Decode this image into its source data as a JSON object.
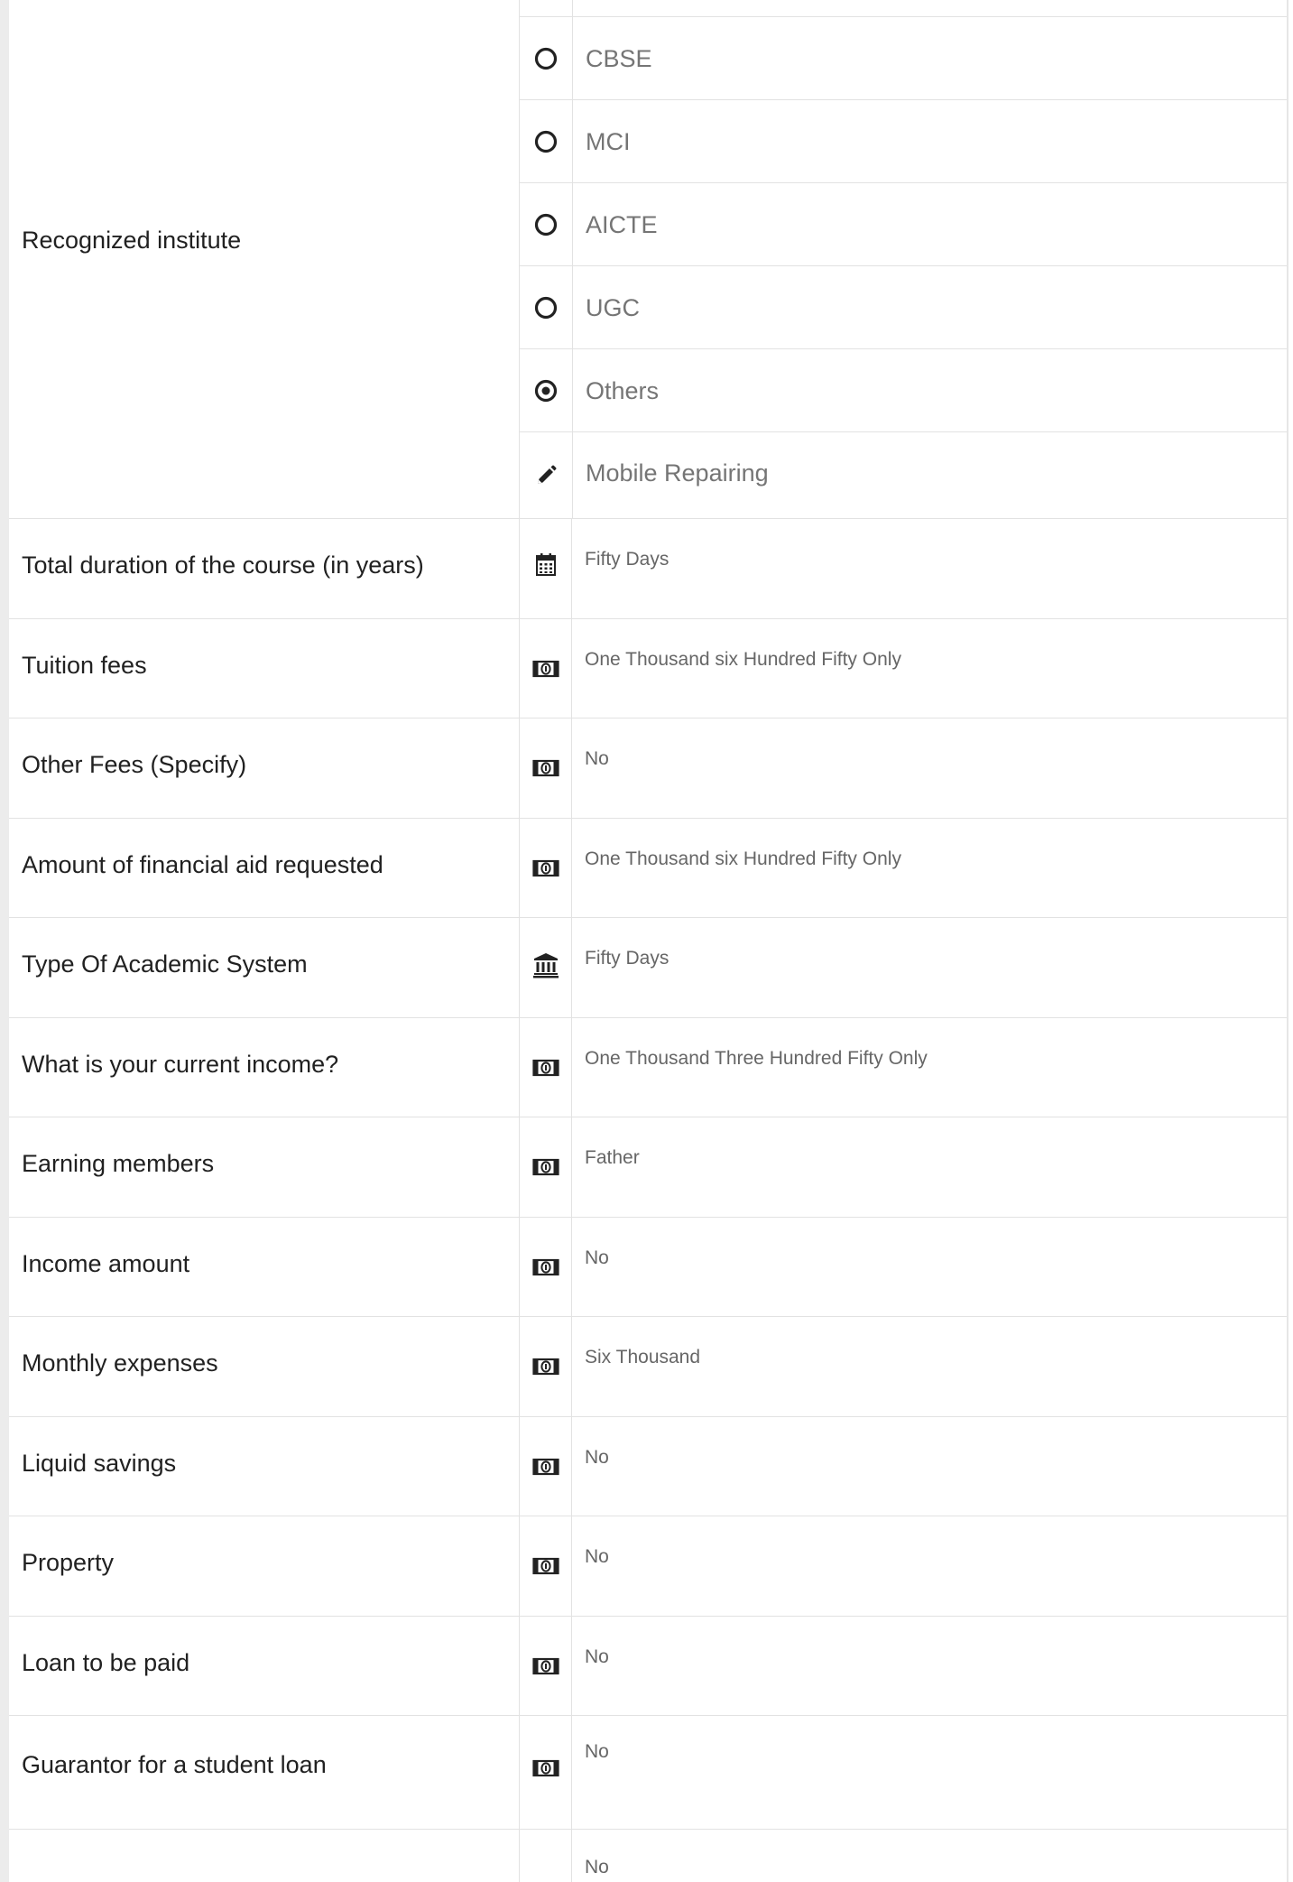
{
  "recognized_institute": {
    "label": "Recognized institute",
    "options": [
      {
        "label": "CBSE",
        "icon": "radio-unchecked-icon",
        "selected": false
      },
      {
        "label": "MCI",
        "icon": "radio-unchecked-icon",
        "selected": false
      },
      {
        "label": "AICTE",
        "icon": "radio-unchecked-icon",
        "selected": false
      },
      {
        "label": "UGC",
        "icon": "radio-unchecked-icon",
        "selected": false
      },
      {
        "label": "Others",
        "icon": "radio-checked-icon",
        "selected": true
      },
      {
        "label": "Mobile Repairing",
        "icon": "pencil-icon",
        "selected": false
      }
    ]
  },
  "fields": [
    {
      "label": "Total duration of the course (in years)",
      "value": "Fifty Days",
      "icon": "calendar-icon"
    },
    {
      "label": "Tuition fees",
      "value": "One Thousand six Hundred Fifty Only",
      "icon": "money-icon"
    },
    {
      "label": "Other Fees (Specify)",
      "value": "No",
      "icon": "money-icon"
    },
    {
      "label": "Amount of financial aid requested",
      "value": "One Thousand six Hundred Fifty Only",
      "icon": "money-icon"
    },
    {
      "label": "Type Of Academic System",
      "value": "Fifty Days",
      "icon": "bank-icon"
    },
    {
      "label": "What is your current income?",
      "value": "One Thousand Three Hundred Fifty Only",
      "icon": "money-icon"
    },
    {
      "label": "Earning members",
      "value": "Father",
      "icon": "money-icon"
    },
    {
      "label": "Income amount",
      "value": "No",
      "icon": "money-icon"
    },
    {
      "label": "Monthly expenses",
      "value": "Six Thousand",
      "icon": "money-icon"
    },
    {
      "label": "Liquid savings",
      "value": "No",
      "icon": "money-icon"
    },
    {
      "label": "Property",
      "value": "No",
      "icon": "money-icon"
    },
    {
      "label": "Loan to be paid",
      "value": "No",
      "icon": "money-icon"
    },
    {
      "label": "Guarantor for a student loan",
      "value": "No",
      "icon": "money-icon"
    },
    {
      "label": "",
      "value": "No",
      "icon": ""
    }
  ]
}
